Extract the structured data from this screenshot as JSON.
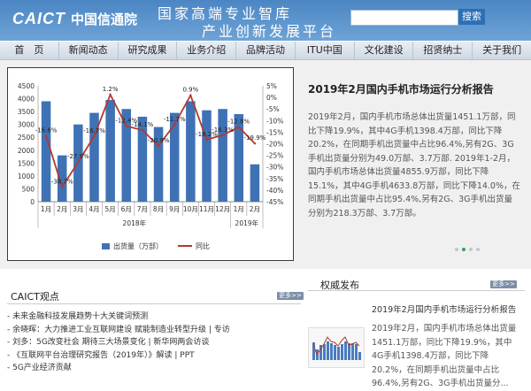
{
  "header": {
    "logo_text": "CAICT",
    "logo_cn": "中国信通院",
    "slogan_line1": "国家高端专业智库",
    "slogan_line2": "产业创新发展平台",
    "search_button": "搜索"
  },
  "nav": [
    "首　页",
    "新闻动态",
    "研究成果",
    "业务介绍",
    "品牌活动",
    "ITU中国",
    "文化建设",
    "招贤纳士",
    "关于我们"
  ],
  "featured": {
    "title": "2019年2月国内手机市场运行分析报告",
    "body": "2019年2月，国内手机市场总体出货量1451.1万部，同比下降19.9%，其中4G手机1398.4万部，同比下降20.2%，在同期手机出货量中占比96.4%,另有2G、3G手机出货量分别为49.0万部、3.7万部. 2019年1-2月，国内手机市场总体出货量4855.9万部，同比下降15.1%，其中4G手机4633.8万部，同比下降14.0%，在同期手机出货量中占比95.4%,另有2G、3G手机出货量分别为218.3万部、3.7万部。"
  },
  "chart_data": {
    "type": "bar",
    "categories": [
      "1月",
      "2月",
      "3月",
      "4月",
      "5月",
      "6月",
      "7月",
      "8月",
      "9月",
      "10月",
      "11月",
      "12月",
      "1月",
      "2月"
    ],
    "year_labels": [
      "2018年",
      "2019年"
    ],
    "series": [
      {
        "name": "出货量（万部）",
        "type": "bar",
        "values": [
          3900,
          1800,
          3000,
          3450,
          3950,
          3600,
          3300,
          2900,
          3450,
          3900,
          3550,
          3600,
          3400,
          1451
        ],
        "color": "#3f72b5"
      },
      {
        "name": "同比",
        "type": "line",
        "values": [
          -16.6,
          -38.7,
          -27.9,
          -16.7,
          1.2,
          -12.4,
          -14.1,
          -20.9,
          -11.7,
          0.9,
          -18.2,
          -16.3,
          -12.8,
          -19.9
        ],
        "color": "#b23a2e"
      }
    ],
    "point_labels": [
      "-16.6%",
      "-38.7%",
      "-27.9%",
      "-16.7%",
      "1.2%",
      "-12.4%",
      "-14.1%",
      "-20.9%",
      "-11.7%",
      "0.9%",
      "-18.2%",
      "-16.3%",
      "-12.8%",
      "-19.9%"
    ],
    "y_left": {
      "min": 0,
      "max": 4500,
      "ticks": [
        "0",
        "500",
        "1000",
        "1500",
        "2000",
        "2500",
        "3000",
        "3500",
        "4000",
        "4500"
      ]
    },
    "y_right": {
      "min": -45,
      "max": 5,
      "ticks": [
        "-45%",
        "-40%",
        "-35%",
        "-30%",
        "-25%",
        "-20%",
        "-15%",
        "-10%",
        "-5%",
        "0%",
        "5%"
      ]
    },
    "legend": "bottom"
  },
  "dots": [
    false,
    true,
    false,
    false
  ],
  "left_section": {
    "title": "CAICT观点",
    "more": "更多>>",
    "items": [
      "- 未来金融科技发展趋势十大关键词预测",
      "- 余晓晖：大力推进工业互联网建设 赋能制造业转型升级 | 专访",
      "- 刘多：5G改变社会 期待三大场景变化 | 新华网两会访谈",
      "- 《互联网平台治理研究报告（2019年）》解读 | PPT",
      "- 5G产业经济贡献"
    ]
  },
  "right_section": {
    "title": "权威发布",
    "more": "更多>>",
    "item_title": "2019年2月国内手机市场运行分析报告",
    "item_text": "2019年2月，国内手机市场总体出货量1451.1万部，同比下降19.9%，其中4G手机1398.4万部，同比下降20.2%，在同期手机出货量中占比96.4%,另有2G、3G手机出货量分..."
  }
}
